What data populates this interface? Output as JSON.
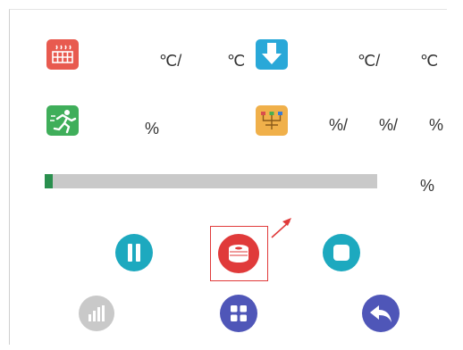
{
  "colors": {
    "bed_icon": "#e85a4f",
    "nozzle_icon": "#29a8d8",
    "speed_icon": "#3fae5a",
    "fan_icon": "#f0b04a",
    "progress_fill": "#2a8f4e",
    "progress_track": "#c9c9c9",
    "pause": "#1da9bf",
    "filament": "#e03a3a",
    "stop": "#1da9bf",
    "stats": "#c9c9c9",
    "menu": "#4f56b8",
    "back": "#4f56b8",
    "highlight_box": "#e03a3a"
  },
  "temps": {
    "bed_sep": "℃/",
    "bed_unit": "℃",
    "nozzle_sep": "℃/",
    "nozzle_unit": "℃"
  },
  "speed": {
    "unit": "%"
  },
  "fans": {
    "sep1": "%/",
    "sep2": "%/",
    "unit": "%"
  },
  "progress": {
    "unit": "%",
    "fraction": 0.025
  },
  "icons": {
    "bed": "heated-bed-icon",
    "nozzle": "nozzle-icon",
    "speed": "running-man-icon",
    "fan": "fan-icon",
    "pause": "pause-icon",
    "filament": "filament-spool-icon",
    "stop": "stop-icon",
    "stats": "bar-chart-icon",
    "menu": "grid-menu-icon",
    "back": "back-arrow-icon"
  }
}
